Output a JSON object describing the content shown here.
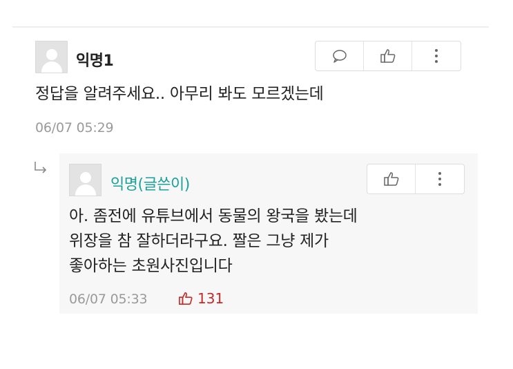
{
  "comment": {
    "author": "익명1",
    "text": "정답을 알려주세요.. 아무리 봐도 모르겠는데",
    "timestamp": "06/07 05:29",
    "actions": [
      "reply-icon",
      "thumbs-up-icon",
      "more-vertical-icon"
    ]
  },
  "reply": {
    "author": "익명(글쓴이)",
    "lines": [
      "아. 좀전에 유튜브에서 동물의 왕국을 봤는데",
      "위장을 참 잘하더라구요. 짤은 그냥 제가",
      "좋아하는 초원사진입니다"
    ],
    "timestamp": "06/07 05:33",
    "like_count": "131",
    "actions": [
      "thumbs-up-icon",
      "more-vertical-icon"
    ]
  },
  "colors": {
    "op_author": "#1aa19a",
    "like": "#c62828",
    "timestamp": "#9a9a9a",
    "reply_bg": "#f7f7f7"
  }
}
